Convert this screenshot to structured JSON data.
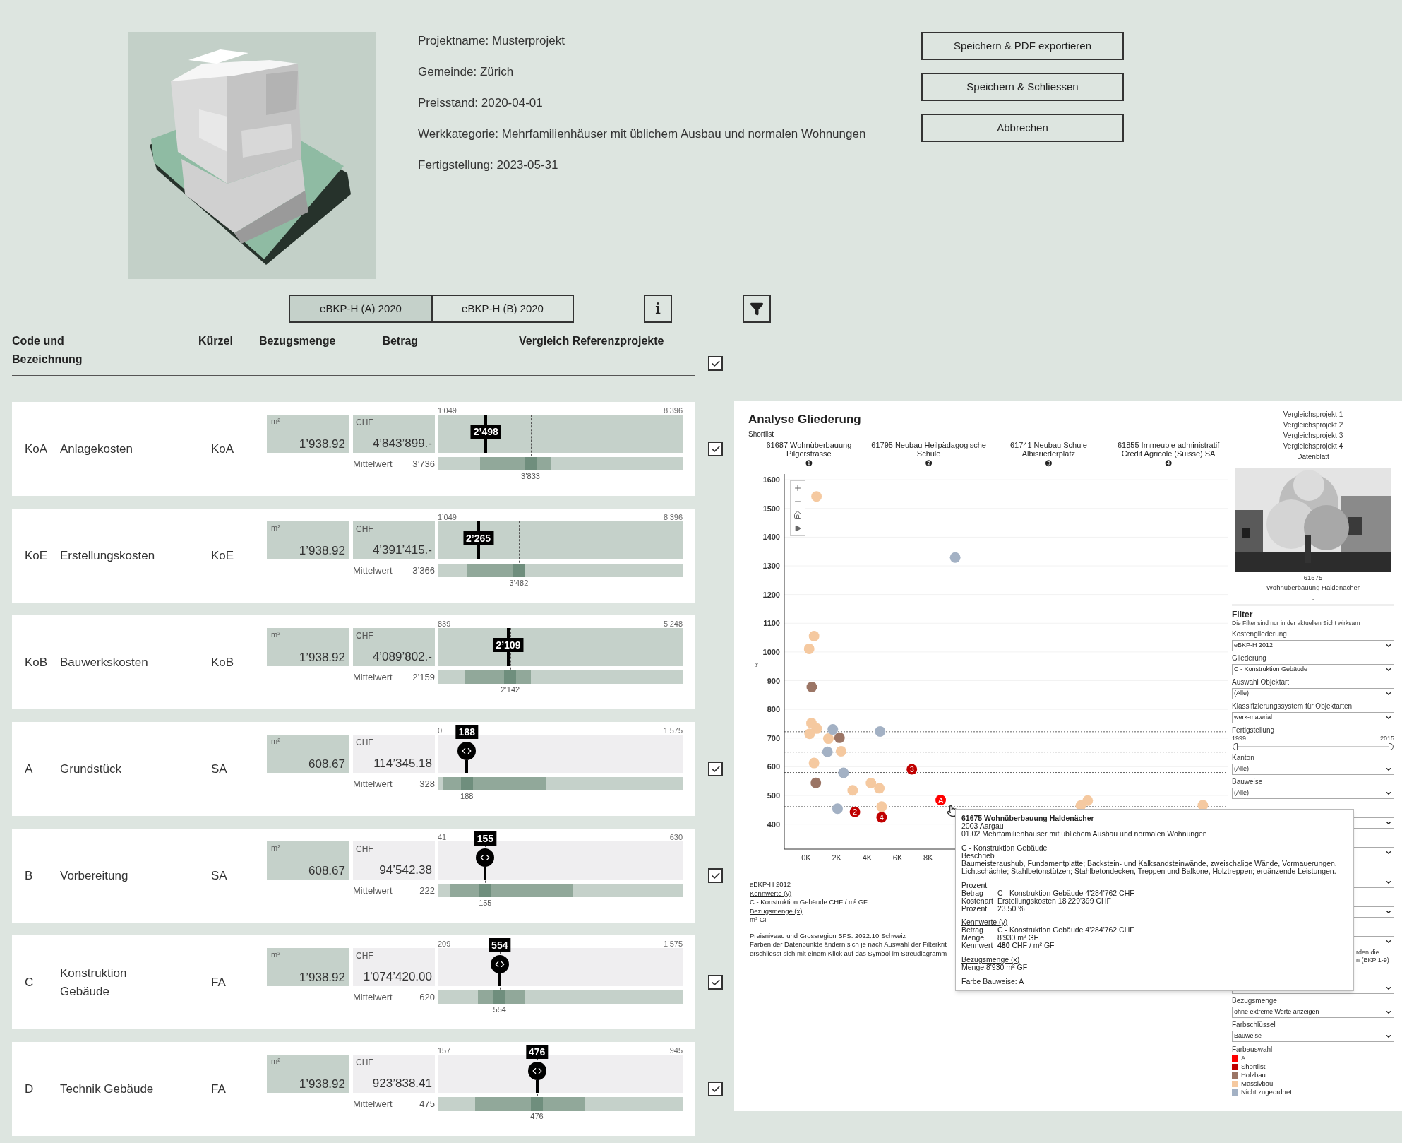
{
  "project_info": [
    "Projektname: Musterprojekt",
    "Gemeinde: Zürich",
    "Preisstand: 2020-04-01",
    "Werkkategorie: Mehrfamilienhäuser mit üblichem Ausbau und normalen Wohnungen",
    "Fertigstellung: 2023-05-31"
  ],
  "actions": [
    "Speichern & PDF exportieren",
    "Speichern & Schliessen",
    "Abbrechen"
  ],
  "tabs": [
    {
      "label": "eBKP-H (A) 2020",
      "selected": true
    },
    {
      "label": "eBKP-H (B) 2020",
      "selected": false
    }
  ],
  "info_button": "i",
  "header": {
    "columns": [
      "Code und Bezeichnung",
      "Kürzel",
      "Bezugsmenge",
      "Betrag",
      "Vergleich Referenzprojekte"
    ],
    "checked": true
  },
  "rows": [
    {
      "kind": "range",
      "code": "KoA",
      "name": "Anlagekosten",
      "short": "KoA",
      "unit": "m²",
      "quantity": "1’938.92",
      "currency": "CHF",
      "amount": "4’843’899.-",
      "mean_label": "Mittelwert",
      "mean": "3’736",
      "min": "1’049",
      "max": "8’396",
      "marker": {
        "value": "2’498",
        "level": 0.197
      },
      "reference": {
        "value": "3’833",
        "level": 0.379
      },
      "band_low": {
        "level": 0.173
      },
      "band_high": {
        "level": 0.462
      },
      "checked": true
    },
    {
      "kind": "range",
      "code": "KoE",
      "name": "Erstellungskosten",
      "short": "KoE",
      "unit": "m²",
      "quantity": "1’938.92",
      "currency": "CHF",
      "amount": "4’391’415.-",
      "mean_label": "Mittelwert",
      "mean": "3’366",
      "min": "1’049",
      "max": "8’396",
      "marker": {
        "value": "2’265",
        "level": 0.166
      },
      "reference": {
        "value": "3’482",
        "level": 0.331
      },
      "band_low": {
        "level": 0.12
      },
      "band_high": {
        "level": 0.35
      }
    },
    {
      "kind": "range",
      "code": "KoB",
      "name": "Bauwerkskosten",
      "short": "KoB",
      "unit": "m²",
      "quantity": "1’938.92",
      "currency": "CHF",
      "amount": "4’089’802.-",
      "mean_label": "Mittelwert",
      "mean": "2’159",
      "min": "839",
      "max": "5’248",
      "marker": {
        "value": "2’109",
        "level": 0.288
      },
      "reference": {
        "value": "2’142",
        "level": 0.296
      },
      "band_low": {
        "level": 0.11
      },
      "band_high": {
        "level": 0.38
      }
    },
    {
      "kind": "pin",
      "code": "A",
      "name": "Grundstück",
      "short": "SA",
      "unit": "m²",
      "quantity": "608.67",
      "currency": "CHF",
      "amount": "114’345.18",
      "mean_label": "Mittelwert",
      "mean": "328",
      "min": "0",
      "max": "1’575",
      "marker": {
        "value": "188",
        "level": 0.119
      },
      "reference": {
        "value": "188",
        "level": 0.119
      },
      "band_low": {
        "level": 0.02
      },
      "band_high": {
        "level": 0.44
      },
      "checked": true
    },
    {
      "kind": "pin",
      "code": "B",
      "name": "Vorbereitung",
      "short": "SA",
      "unit": "m²",
      "quantity": "608.67",
      "currency": "CHF",
      "amount": "94’542.38",
      "mean_label": "Mittelwert",
      "mean": "222",
      "min": "41",
      "max": "630",
      "marker": {
        "value": "155",
        "level": 0.194
      },
      "reference": {
        "value": "155",
        "level": 0.194
      },
      "band_low": {
        "level": 0.05
      },
      "band_high": {
        "level": 0.55
      },
      "checked": true
    },
    {
      "kind": "pin",
      "code": "C",
      "name": "Konstruktion Gebäude",
      "short": "FA",
      "unit": "m²",
      "quantity": "1’938.92",
      "currency": "CHF",
      "amount": "1’074’420.00",
      "mean_label": "Mittelwert",
      "mean": "620",
      "min": "209",
      "max": "1’575",
      "marker": {
        "value": "554",
        "level": 0.253
      },
      "reference": {
        "value": "554",
        "level": 0.253
      },
      "band_low": {
        "level": 0.164
      },
      "band_high": {
        "level": 0.354
      },
      "checked": true
    },
    {
      "kind": "pin",
      "code": "D",
      "name": "Technik Gebäude",
      "short": "FA",
      "unit": "m²",
      "quantity": "1’938.92",
      "currency": "CHF",
      "amount": "923’838.41",
      "mean_label": "Mittelwert",
      "mean": "475",
      "min": "157",
      "max": "945",
      "marker": {
        "value": "476",
        "level": 0.405
      },
      "reference": {
        "value": "476",
        "level": 0.405
      },
      "band_low": {
        "level": 0.153
      },
      "band_high": {
        "level": 0.6
      },
      "checked": true
    }
  ],
  "analysis": {
    "title": "Analyse Gliederung",
    "subtitle": "Shortlist",
    "projects": [
      {
        "name": "61687 Wohnüberbauung Pilgerstrasse",
        "number": "❶"
      },
      {
        "name": "61795 Neubau Heilpädagogische Schule",
        "number": "❷"
      },
      {
        "name": "61741 Neubau Schule Albisriederplatz",
        "number": "❸"
      },
      {
        "name": "61855 Immeuble administratif Crédit Agricole (Suisse) SA",
        "number": "❹"
      }
    ],
    "chart_data": {
      "type": "scatter",
      "ylabel": "y",
      "xlim": [
        -1.43,
        27.67
      ],
      "ylim": [
        313,
        1620
      ],
      "xticks": [
        {
          "value": 0,
          "label": "0K"
        },
        {
          "value": 2,
          "label": "2K"
        },
        {
          "value": 4,
          "label": "4K"
        },
        {
          "value": 6,
          "label": "6K"
        },
        {
          "value": 8,
          "label": "8K"
        }
      ],
      "yticks": [
        400,
        500,
        600,
        700,
        800,
        900,
        1000,
        1100,
        1200,
        1300,
        1400,
        1500,
        1600
      ],
      "grid": true,
      "series": [
        {
          "name": "A",
          "color": "#ff0000",
          "x": [
            8.82
          ],
          "values": [
            484
          ]
        },
        {
          "name": "Shortlist",
          "color": "#c00000",
          "x": [
            3.2,
            4.95,
            6.93
          ],
          "values": [
            443,
            424,
            591
          ]
        },
        {
          "name": "Holzbau",
          "color": "#9b7565",
          "x": [
            0.37,
            2.19,
            0.64
          ],
          "values": [
            878,
            701,
            544
          ]
        },
        {
          "name": "Massivbau",
          "color": "#f5c9a0",
          "x": [
            0.68,
            0.52,
            0.2,
            0.35,
            0.7,
            0.23,
            1.46,
            2.29,
            0.52,
            3.05,
            4.25,
            4.8,
            4.95,
            18.0,
            18.45,
            26.0
          ],
          "values": [
            1542,
            1055,
            1011,
            752,
            733,
            715,
            698,
            654,
            613,
            518,
            543,
            525,
            461,
            465,
            482,
            466
          ]
        },
        {
          "name": "Nicht zugeordnet",
          "color": "#a3b1c4",
          "x": [
            1.75,
            1.4,
            2.45,
            4.85,
            9.77,
            2.06
          ],
          "values": [
            730,
            652,
            579,
            723,
            1329,
            454
          ]
        }
      ],
      "ref_lines": [
        {
          "axis": "y",
          "value": 722
        },
        {
          "axis": "y",
          "value": 651
        },
        {
          "axis": "y",
          "value": 580
        },
        {
          "axis": "y",
          "value": 461
        }
      ],
      "annotations": [
        {
          "x": 3.2,
          "y": 443,
          "text": "2"
        },
        {
          "x": 4.95,
          "y": 424,
          "text": "4"
        },
        {
          "x": 6.93,
          "y": 591,
          "text": "3"
        }
      ]
    },
    "hovered_point_label": "A",
    "notes": [
      {
        "kind": "text",
        "text": "eBKP-H 2012"
      },
      {
        "kind": "heading",
        "text": "Kennwerte (y)"
      },
      {
        "kind": "text",
        "text": "C - Konstruktion Gebäude CHF / m² GF"
      },
      {
        "kind": "heading",
        "text": "Bezugsmenge (x)"
      },
      {
        "kind": "text",
        "text": "m² GF"
      },
      {
        "kind": "blank"
      },
      {
        "kind": "text",
        "text": "Preisniveau und Grossregion BFS: 2022.10 Schweiz"
      },
      {
        "kind": "text",
        "text": "Farben der Datenpunkte ändern sich je nach Auswahl der Filterkrit"
      },
      {
        "kind": "text",
        "text": "erschliesst sich mit einem Klick auf das Symbol im Streudiagramm"
      }
    ],
    "tooltip": [
      {
        "kind": "title",
        "text": "61675 Wohnüberbauung Haldenächer"
      },
      {
        "kind": "text",
        "text": "2003 Aargau"
      },
      {
        "kind": "text",
        "text": "01.02 Mehrfamilienhäuser mit üblichem Ausbau und normalen Wohnungen"
      },
      {
        "kind": "blank"
      },
      {
        "kind": "text",
        "text": "C - Konstruktion Gebäude"
      },
      {
        "kind": "text",
        "text": "Beschrieb"
      },
      {
        "kind": "paragraph",
        "text": "Baumeisteraushub, Fundamentplatte; Backstein- und Kalksandsteinwände, zweischalige Wände, Vormauerungen, Lichtschächte; Stahlbetonstützen; Stahlbetondecken, Treppen und Balkone, Holztreppen; ergänzende Leistungen."
      },
      {
        "kind": "blank"
      },
      {
        "kind": "text",
        "text": "Prozent"
      },
      {
        "kind": "pair",
        "label": "Betrag",
        "text": "C - Konstruktion Gebäude 4'284'762 CHF"
      },
      {
        "kind": "pair",
        "label": "Kostenart",
        "text": "Erstellungskosten 18'229'399 CHF"
      },
      {
        "kind": "pair",
        "label": "Prozent",
        "text": "23.50 %"
      },
      {
        "kind": "blank"
      },
      {
        "kind": "heading",
        "text": "Kennwerte (y)"
      },
      {
        "kind": "pair",
        "label": "Betrag",
        "text": "C - Konstruktion Gebäude 4'284'762 CHF"
      },
      {
        "kind": "pair",
        "label": "Menge",
        "text": "8'930 m² GF"
      },
      {
        "kind": "pair",
        "label": "Kennwert",
        "text": "**480** CHF / m² GF"
      },
      {
        "kind": "blank"
      },
      {
        "kind": "heading",
        "text": "Bezugsmenge (x)"
      },
      {
        "kind": "text",
        "text": "Menge 8'930 m² GF"
      },
      {
        "kind": "blank"
      },
      {
        "kind": "text",
        "text": "Farbe Bauweise: A"
      }
    ],
    "sidebar": {
      "links": [
        "Vergleichsprojekt 1",
        "Vergleichsprojekt 2",
        "Vergleichsprojekt 3",
        "Vergleichsprojekt 4",
        "Datenblatt"
      ],
      "photo_caption": [
        "61675",
        "Wohnüberbauung Haldenächer",
        "."
      ],
      "filter": {
        "title": "Filter",
        "hint": "Die Filter sind nur in der aktuellen Sicht wirksam",
        "fields": [
          {
            "kind": "select",
            "label": "Kostengliederung",
            "value": "eBKP-H 2012"
          },
          {
            "kind": "select",
            "label": "Gliederung",
            "value": "C - Konstruktion Gebäude"
          },
          {
            "kind": "select",
            "label": "Auswahl Objektart",
            "value": "(Alle)"
          },
          {
            "kind": "select",
            "label": "Klassifizierungssystem für Objektarten",
            "value": "werk-material"
          },
          {
            "kind": "range",
            "label": "Fertigstellung",
            "min": "1999",
            "max": "2015",
            "from": {
              "level": 0
            },
            "to": {
              "level": 1
            }
          },
          {
            "kind": "select",
            "label": "Kanton",
            "value": "(Alle)"
          },
          {
            "kind": "select",
            "label": "Bauweise",
            "value": "(Alle)"
          },
          {
            "kind": "select"
          },
          {
            "kind": "select"
          },
          {
            "kind": "select"
          },
          {
            "kind": "select"
          },
          {
            "kind": "select"
          },
          {
            "kind": "note",
            "lines": [
              "rden die",
              "n (BKP 1-9)"
            ]
          },
          {
            "kind": "select"
          },
          {
            "kind": "select",
            "label": "Bezugsmenge",
            "value": "ohne extreme Werte anzeigen"
          },
          {
            "kind": "select",
            "label": "Farbschlüssel",
            "value": "Bauweise"
          }
        ],
        "legend_title": "Farbauswahl"
      }
    }
  }
}
